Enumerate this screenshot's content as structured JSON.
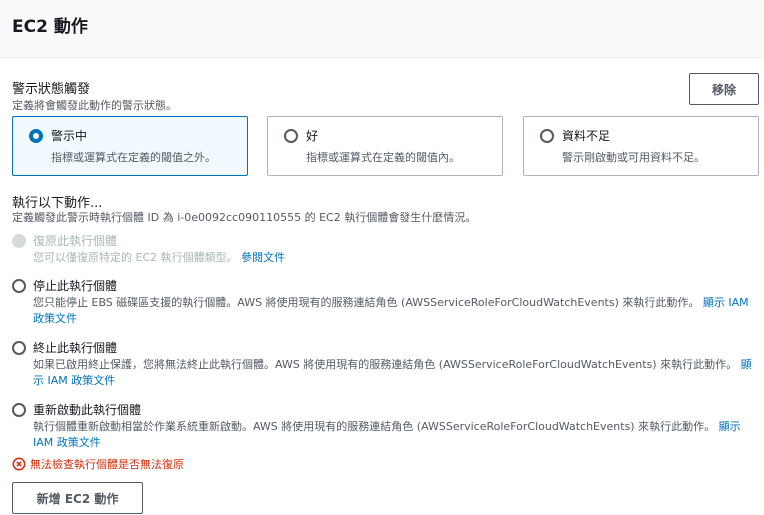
{
  "header": {
    "title": "EC2 動作"
  },
  "alarm_state": {
    "title": "警示狀態觸發",
    "description": "定義將會觸發此動作的警示狀態。",
    "remove_label": "移除",
    "options": [
      {
        "label": "警示中",
        "description": "指標或運算式在定義的閾值之外。",
        "selected": true
      },
      {
        "label": "好",
        "description": "指標或運算式在定義的閾值內。",
        "selected": false
      },
      {
        "label": "資料不足",
        "description": "警示剛啟動或可用資料不足。",
        "selected": false
      }
    ]
  },
  "actions": {
    "title": "執行以下動作...",
    "description": "定義觸發此警示時執行個體 ID 為 i-0e0092cc090110555 的 EC2 執行個體會發生什麼情況。",
    "options": [
      {
        "label": "復原此執行個體",
        "description": "您可以僅復原特定的 EC2 執行個體類型。",
        "link": "參閱文件",
        "disabled": true
      },
      {
        "label": "停止此執行個體",
        "description": "您只能停止 EBS 磁碟區支援的執行個體。AWS 將使用現有的服務連結角色 (AWSServiceRoleForCloudWatchEvents) 來執行此動作。",
        "link": "顯示 IAM 政策文件",
        "disabled": false
      },
      {
        "label": "終止此執行個體",
        "description": "如果已啟用終止保護，您將無法終止此執行個體。AWS 將使用現有的服務連結角色 (AWSServiceRoleForCloudWatchEvents) 來執行此動作。",
        "link": "顯示 IAM 政策文件",
        "disabled": false
      },
      {
        "label": "重新啟動此執行個體",
        "description": "執行個體重新啟動相當於作業系統重新啟動。AWS 將使用現有的服務連結角色 (AWSServiceRoleForCloudWatchEvents) 來執行此動作。",
        "link": "顯示 IAM 政策文件",
        "disabled": false
      }
    ],
    "error": "無法檢查執行個體是否無法復原"
  },
  "add_button_label": "新增 EC2 動作",
  "colors": {
    "accent": "#0073bb",
    "error": "#d13212",
    "text": "#16191f",
    "muted": "#545b64"
  }
}
